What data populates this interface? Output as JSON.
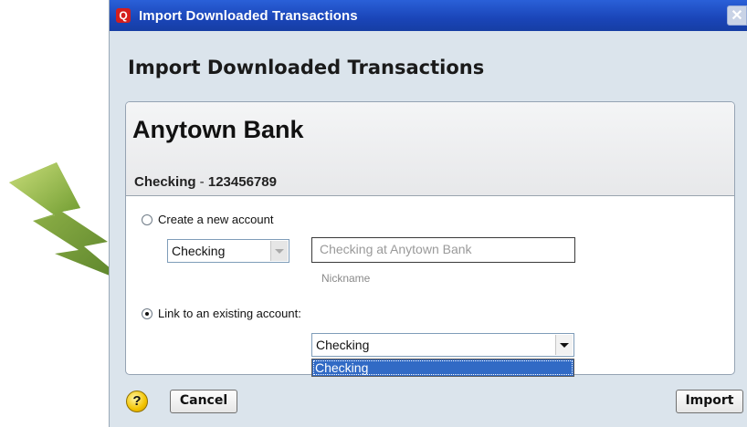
{
  "window": {
    "title": "Import Downloaded Transactions",
    "app_icon": "Q",
    "close_glyph": "✕"
  },
  "heading": "Import Downloaded Transactions",
  "bank": {
    "name": "Anytown Bank",
    "account_type": "Checking",
    "account_number": "123456789",
    "separator": " - "
  },
  "options": {
    "create_new": {
      "label": "Create a new account",
      "selected": false,
      "type_value": "Checking",
      "nickname_value": "Checking at Anytown Bank",
      "nickname_label": "Nickname"
    },
    "link_existing": {
      "label": "Link to an existing account:",
      "selected": true,
      "selected_value": "Checking",
      "dropdown_options": [
        "Checking"
      ]
    }
  },
  "buttons": {
    "help": "?",
    "cancel": "Cancel",
    "import": "Import"
  },
  "colors": {
    "title_bar": "#1a45b8",
    "dialog_bg": "#dbe4ec",
    "selection": "#316ac5",
    "arrow_icon": "#7aa43a"
  },
  "icons": {
    "app": "quicken-q-icon",
    "close": "close-icon",
    "help": "help-icon",
    "arrow": "lightning-arrow-icon"
  }
}
